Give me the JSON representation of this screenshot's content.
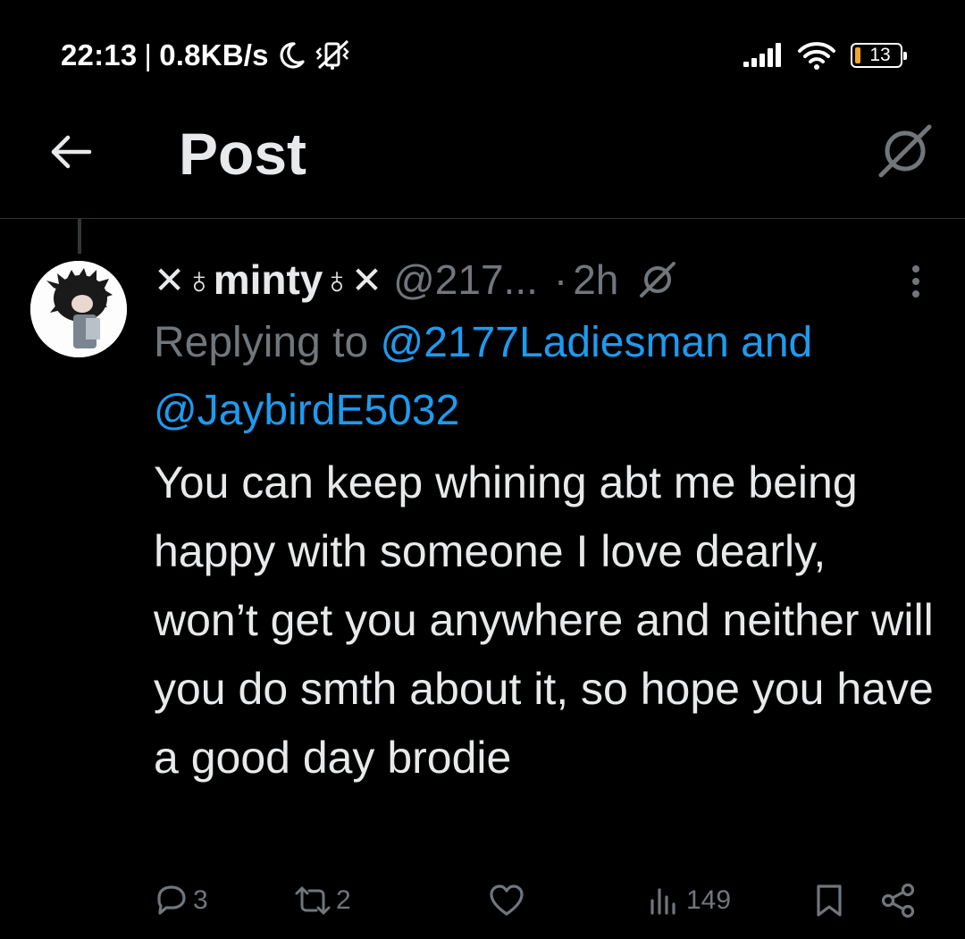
{
  "status_bar": {
    "time": "22:13",
    "separator": "|",
    "net_speed": "0.8KB/s",
    "battery_level": "13",
    "battery_fill_fraction": 0.13,
    "battery_color": "#f5a623",
    "icons": [
      "moon-icon",
      "vibrate-mute-icon",
      "signal-icon",
      "wifi-icon",
      "battery-icon"
    ]
  },
  "header": {
    "title": "Post",
    "back_icon": "arrow-left-icon",
    "grok_icon": "grok-icon"
  },
  "post": {
    "display_name": {
      "prefix": "✕♁",
      "core": "minty",
      "suffix": "♁✕"
    },
    "handle": "@217...",
    "dot": "·",
    "time": "2h",
    "replying_prefix": "Replying to",
    "mention_1": "@2177Ladiesman",
    "replying_and": "and",
    "mention_2": "@JaybirdE5032",
    "text": "You can keep whining abt me being happy with someone I love dearly, won’t get you anywhere and neither will you do smth about it, so hope you have a good day brodie",
    "actions": {
      "replies": "3",
      "reposts": "2",
      "likes": "",
      "views": "149"
    }
  },
  "colors": {
    "background": "#000000",
    "text": "#e7e9ea",
    "muted": "#71767b",
    "accent": "#1d9bf0",
    "divider": "#2f3336"
  }
}
